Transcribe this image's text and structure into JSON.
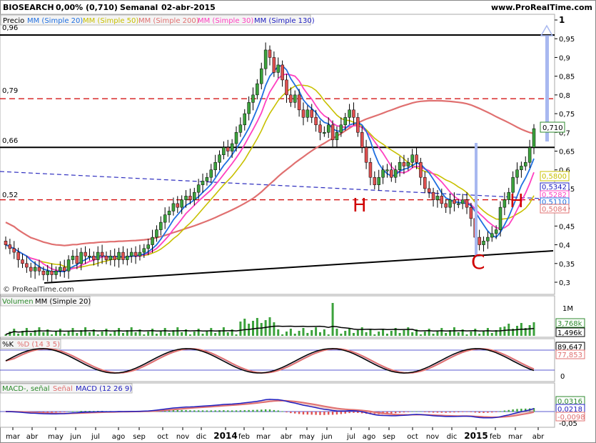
{
  "header": {
    "symbol": "BIOSEARCH",
    "change": "0,00% (0,710)",
    "period": "Semanal",
    "date": "02-abr-2015",
    "site": "www.ProRealTime.com",
    "copyright": "© ProRealTime.com"
  },
  "price_legend": {
    "price_label": "Precio",
    "items": [
      {
        "label": "MM (Simple 20)",
        "color": "#1f6fe0"
      },
      {
        "label": "MM (Simple 50)",
        "color": "#d8d000"
      },
      {
        "label": "MM (Simple 200)",
        "color": "#e07070"
      },
      {
        "label": "MM (Simple 30)",
        "color": "#ff40c0"
      },
      {
        "label": "MM (Simple 130)",
        "color": "#2020c0"
      }
    ]
  },
  "level_labels": [
    "0,96",
    "0,79",
    "0,66",
    "0,52"
  ],
  "price_boxes": [
    "0,710",
    "0,5800",
    "0,5342",
    "0,5282",
    "0,5110",
    "0,5084"
  ],
  "annotations": [
    "H",
    "H",
    "C"
  ],
  "volume_panel": {
    "label1": "Volumen",
    "label2": "MM (Simple 20)",
    "scale": "1M",
    "box1": "3,768k",
    "box2": "1,496k"
  },
  "stoch_panel": {
    "label1": "%K",
    "label2": "%D (14 3 5)",
    "box1": "89,647",
    "box2": "77,853",
    "tick0": "0"
  },
  "macd_panel": {
    "label1": "MACD-, señal",
    "label2": "Señal",
    "label3": "MACD (12 26 9)",
    "box1": "0,0316",
    "box2": "0,0218",
    "box3": "-0,0098",
    "tick_neg": "-0,05"
  },
  "x_labels": [
    "mar",
    "abr",
    "may",
    "jun",
    "jul",
    "ago",
    "sep",
    "oct",
    "nov",
    "dic",
    "2014",
    "feb",
    "mar",
    "abr",
    "may",
    "jun",
    "jul",
    "ago",
    "sep",
    "oct",
    "nov",
    "dic",
    "2015",
    "feb",
    "mar",
    "abr"
  ],
  "chart_data": {
    "type": "candlestick",
    "title": "BIOSEARCH Semanal",
    "y_ticks": [
      "1",
      "0,95",
      "0,9",
      "0,85",
      "0,8",
      "0,75",
      "0,7",
      "0,65",
      "0,6",
      "0,55",
      "0,5",
      "0,45",
      "0,4",
      "0,35",
      "0,3"
    ],
    "ylim": [
      0.28,
      1.0
    ],
    "horizontal_lines": [
      {
        "value": 0.96,
        "style": "solid"
      },
      {
        "value": 0.79,
        "style": "dashed-red"
      },
      {
        "value": 0.66,
        "style": "solid"
      },
      {
        "value": 0.52,
        "style": "dashed-red"
      }
    ],
    "close": [
      0.4,
      0.39,
      0.38,
      0.36,
      0.35,
      0.34,
      0.33,
      0.34,
      0.33,
      0.32,
      0.33,
      0.32,
      0.33,
      0.34,
      0.33,
      0.36,
      0.37,
      0.35,
      0.38,
      0.37,
      0.37,
      0.36,
      0.38,
      0.37,
      0.36,
      0.37,
      0.36,
      0.38,
      0.36,
      0.37,
      0.38,
      0.37,
      0.38,
      0.39,
      0.4,
      0.42,
      0.44,
      0.46,
      0.48,
      0.49,
      0.51,
      0.5,
      0.52,
      0.53,
      0.52,
      0.54,
      0.56,
      0.57,
      0.58,
      0.6,
      0.62,
      0.64,
      0.66,
      0.65,
      0.67,
      0.7,
      0.72,
      0.75,
      0.78,
      0.8,
      0.83,
      0.87,
      0.92,
      0.9,
      0.86,
      0.88,
      0.84,
      0.8,
      0.78,
      0.8,
      0.76,
      0.74,
      0.76,
      0.74,
      0.72,
      0.7,
      0.7,
      0.72,
      0.68,
      0.7,
      0.72,
      0.74,
      0.76,
      0.74,
      0.7,
      0.66,
      0.62,
      0.58,
      0.56,
      0.58,
      0.6,
      0.6,
      0.58,
      0.6,
      0.62,
      0.61,
      0.62,
      0.64,
      0.62,
      0.58,
      0.55,
      0.54,
      0.52,
      0.53,
      0.51,
      0.5,
      0.52,
      0.51,
      0.51,
      0.52,
      0.5,
      0.47,
      0.42,
      0.4,
      0.41,
      0.42,
      0.43,
      0.44,
      0.5,
      0.52,
      0.54,
      0.58,
      0.6,
      0.61,
      0.62,
      0.66,
      0.71
    ]
  }
}
